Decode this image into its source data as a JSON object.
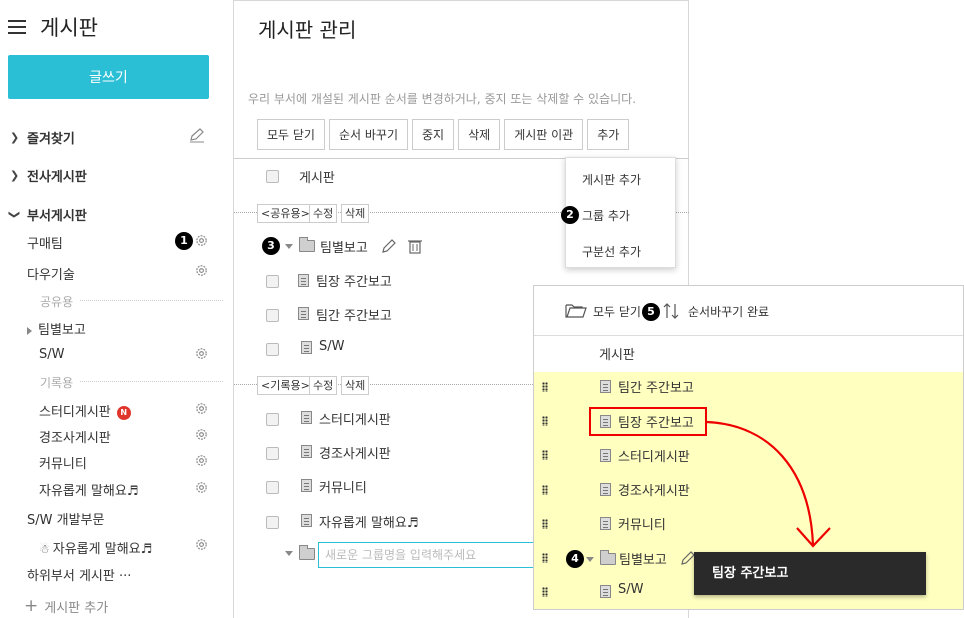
{
  "sidebar": {
    "title": "게시판",
    "write_label": "글쓰기",
    "sections": {
      "favorites": "즐겨찾기",
      "company": "전사게시판",
      "department": "부서게시판"
    },
    "boards": {
      "purchase": "구매팀",
      "dawoo": "다우기술",
      "shared_label": "공유용",
      "team_report": "팀별보고",
      "sw": "S/W",
      "record_label": "기록용",
      "study": "스터디게시판",
      "study_badge": "N",
      "events": "경조사게시판",
      "community": "커뮤니티",
      "free_talk": "자유롭게 말해요♬",
      "sw_dev": "S/W 개발부문",
      "sw_free": "자유롭게 말해요♬",
      "sub_dept": "하위부서 게시판 ···",
      "add_board": "게시판 추가"
    }
  },
  "main": {
    "title": "게시판 관리",
    "description": "우리 부서에 개설된 게시판 순서를 변경하거나, 중지 또는 삭제할 수 있습니다.",
    "toolbar": [
      "모두 닫기",
      "순서 바꾸기",
      "중지",
      "삭제",
      "게시판 이관",
      "추가"
    ],
    "header_label": "게시판",
    "shared_tag": "<공유용>",
    "record_tag": "<기록용>",
    "edit_label": "수정",
    "delete_label": "삭제",
    "team_report": "팀별보고",
    "rows_shared": [
      "팀장 주간보고",
      "팀간 주간보고",
      "S/W"
    ],
    "rows_record": [
      "스터디게시판",
      "경조사게시판",
      "커뮤니티",
      "자유롭게 말해요♬"
    ],
    "new_group_placeholder": "새로운 그룹명을 입력해주세요"
  },
  "dropdown": {
    "items": [
      "게시판 추가",
      "그룹 추가",
      "구분선 추가"
    ]
  },
  "overlay": {
    "collapse_label": "모두 닫기",
    "reorder_done": "순서바꾸기 완료",
    "header_label": "게시판",
    "rows": [
      "팀간 주간보고",
      "팀장 주간보고",
      "스터디게시판",
      "경조사게시판",
      "커뮤니티",
      "팀별보고",
      "S/W"
    ]
  },
  "tooltip": "팀장 주간보고",
  "callouts": [
    "1",
    "2",
    "3",
    "4",
    "5"
  ],
  "colors": {
    "accent": "#2bbfd5",
    "highlight": "#ffffc0",
    "annotation": "#e00000"
  }
}
